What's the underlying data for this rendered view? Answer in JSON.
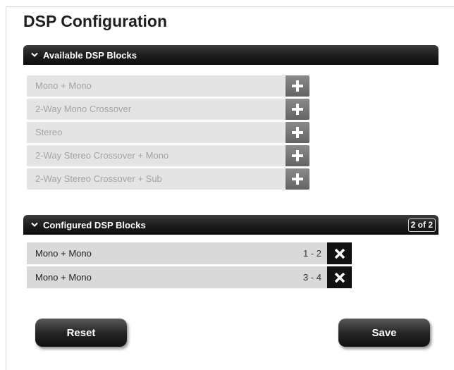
{
  "page": {
    "title": "DSP Configuration"
  },
  "available": {
    "header": "Available DSP Blocks",
    "items": [
      {
        "label": "Mono + Mono"
      },
      {
        "label": "2-Way Mono Crossover"
      },
      {
        "label": "Stereo"
      },
      {
        "label": "2-Way Stereo Crossover + Mono"
      },
      {
        "label": "2-Way Stereo Crossover + Sub"
      }
    ],
    "add_icon": "plus-icon"
  },
  "configured": {
    "header": "Configured DSP Blocks",
    "count": "2 of 2",
    "items": [
      {
        "label": "Mono + Mono",
        "range": "1 - 2"
      },
      {
        "label": "Mono + Mono",
        "range": "3 - 4"
      }
    ],
    "remove_icon": "close-icon"
  },
  "actions": {
    "reset": "Reset",
    "save": "Save"
  },
  "colors": {
    "header_bg": "#1c1c1c",
    "available_row_bg": "#e4e4e4",
    "configured_row_bg": "#d9d9d9",
    "add_button_bg": "#757575",
    "remove_button_bg": "#111111"
  }
}
